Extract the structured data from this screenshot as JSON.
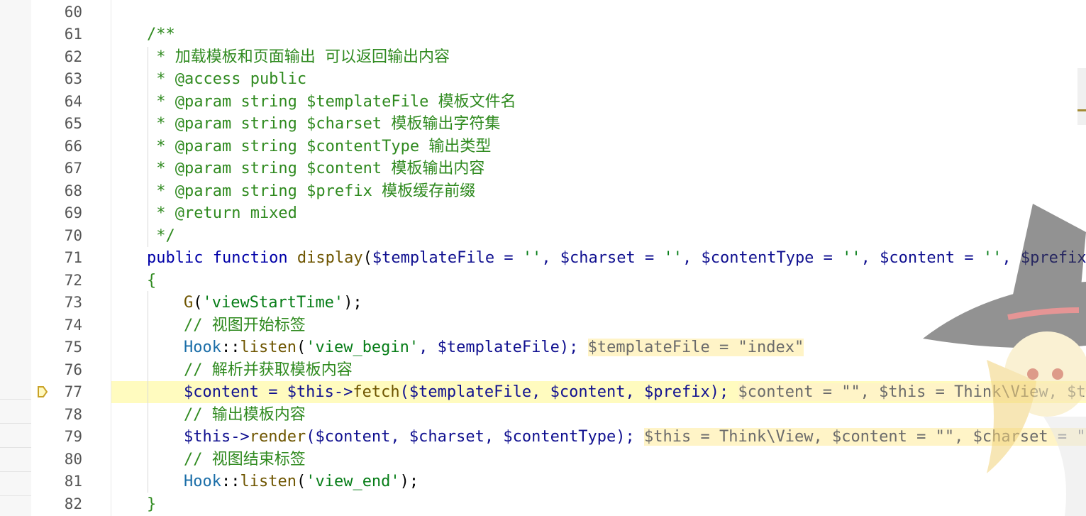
{
  "breakpoint_line": "77",
  "lines": [
    {
      "n": "60"
    },
    {
      "n": "61",
      "t": "/**"
    },
    {
      "n": "62",
      "t": " * 加载模板和页面输出 可以返回输出内容"
    },
    {
      "n": "63",
      "t": " * @access public"
    },
    {
      "n": "64",
      "t": " * @param string $templateFile 模板文件名"
    },
    {
      "n": "65",
      "t": " * @param string $charset 模板输出字符集"
    },
    {
      "n": "66",
      "t": " * @param string $contentType 输出类型"
    },
    {
      "n": "67",
      "t": " * @param string $content 模板输出内容"
    },
    {
      "n": "68",
      "t": " * @param string $prefix 模板缓存前缀"
    },
    {
      "n": "69",
      "t": " * @return mixed"
    },
    {
      "n": "70",
      "t": " */"
    },
    {
      "n": "71",
      "a": "public function ",
      "b": "display",
      "c": "(",
      "d": "$templateFile = ",
      "e": "''",
      "f": ", $charset = ",
      "g": "''",
      "h": ", $contentType = ",
      "i": "''",
      "j": ", $content = ",
      "k": "''",
      "l": ", $prefix ="
    },
    {
      "n": "72",
      "t": "{"
    },
    {
      "n": "73",
      "a": "G",
      "b": "(",
      "c": "'viewStartTime'",
      "d": ");"
    },
    {
      "n": "74",
      "t": "// 视图开始标签"
    },
    {
      "n": "75",
      "a": "Hook",
      "b": "::",
      "c": "listen",
      "d": "(",
      "e": "'view_begin'",
      "f": ", $templateFile);",
      "hint": "$templateFile = \"index\""
    },
    {
      "n": "76",
      "t": "// 解析并获取模板内容"
    },
    {
      "n": "77",
      "a": "$content = $this->",
      "b": "fetch",
      "c": "($templateFile, $content, $prefix);",
      "hint": "$content = \"\", $this = Think\\View, $tem"
    },
    {
      "n": "78",
      "t": "// 输出模板内容"
    },
    {
      "n": "79",
      "a": "$this->",
      "b": "render",
      "c": "($content, $charset, $contentType);",
      "hint": "$this = Think\\View, $content = \"\", $charset = \"\","
    },
    {
      "n": "80",
      "t": "// 视图结束标签"
    },
    {
      "n": "81",
      "a": "Hook",
      "b": "::",
      "c": "listen",
      "d": "(",
      "e": "'view_end'",
      "f": ");"
    },
    {
      "n": "82",
      "t": "}"
    }
  ]
}
